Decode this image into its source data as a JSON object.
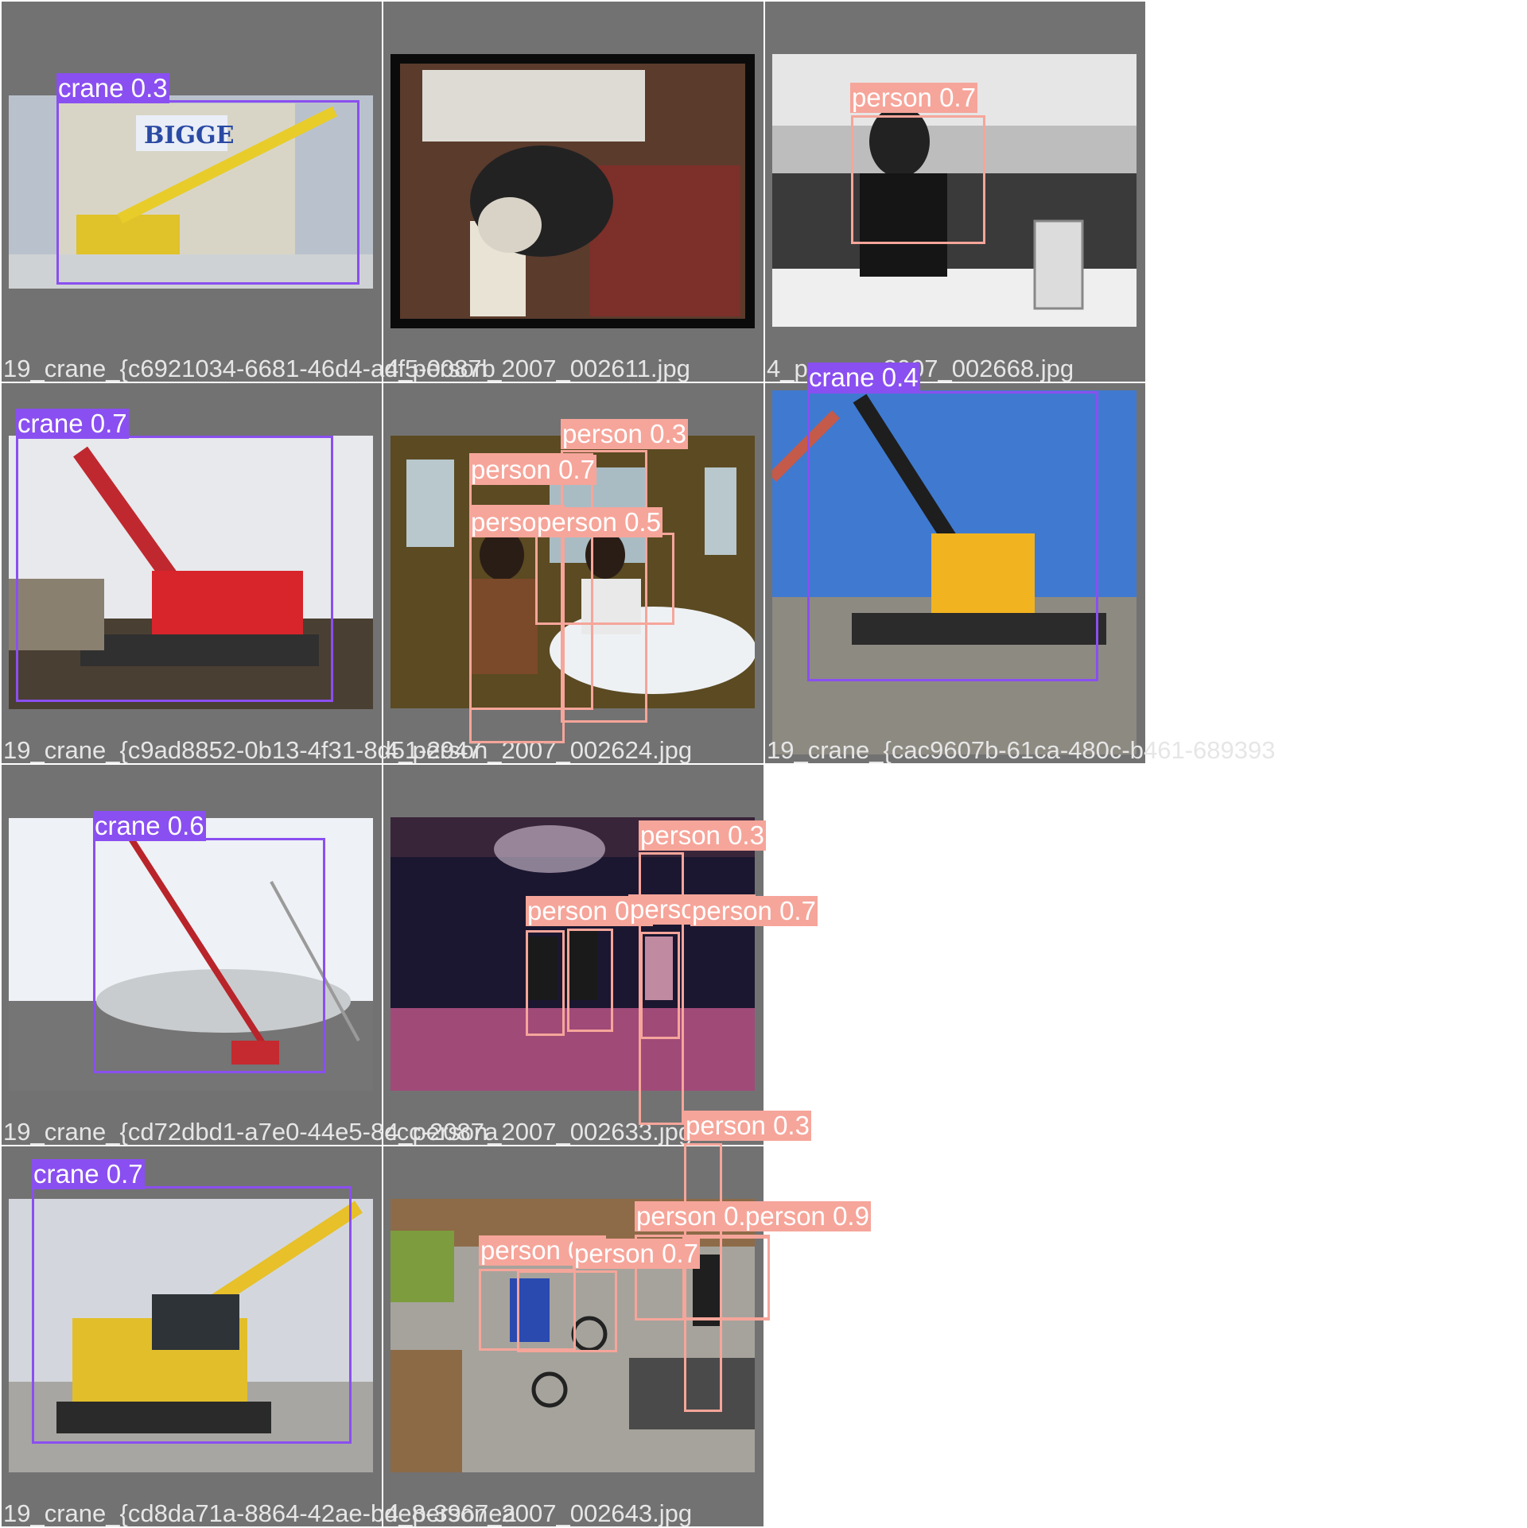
{
  "colors": {
    "crane": "#8a4ff0",
    "person": "#f6a59a",
    "tile_bg": "#727272"
  },
  "tiles": [
    {
      "filename": "19_crane_{c6921034-6681-46d4-adf5-0087b"
    },
    {
      "filename": "4_person_2007_002611.jpg"
    },
    {
      "filename": "4_person_2007_002668.jpg"
    },
    {
      "filename": "19_crane_{c9ad8852-0b13-4f31-8d51-2947"
    },
    {
      "filename": "4_person_2007_002624.jpg"
    },
    {
      "filename": "19_crane_{cac9607b-61ca-480c-b461-689393"
    },
    {
      "filename": "19_crane_{cd72dbd1-a7e0-44e5-8ccc-2087a"
    },
    {
      "filename": "4_person_2007_002633.jpg"
    },
    {
      "filename": "19_crane_{cd8da71a-8864-42ae-bde8-3967ea"
    },
    {
      "filename": "4_person_2007_002643.jpg"
    }
  ],
  "detections": [
    {
      "label": "crane 0.3"
    },
    {
      "label": "person 0.7"
    },
    {
      "label": "crane 0.7"
    },
    {
      "label": "person 0.3"
    },
    {
      "label": "person 0.7"
    },
    {
      "label": "person 0.7"
    },
    {
      "label": "person 0.5"
    },
    {
      "label": "crane 0.4"
    },
    {
      "label": "crane 0.6"
    },
    {
      "label": "person 0.3"
    },
    {
      "label": "person 0.6"
    },
    {
      "label": "person 0.6"
    },
    {
      "label": "person 0.7"
    },
    {
      "label": "person 0.3"
    },
    {
      "label": "crane 0.7"
    },
    {
      "label": "person 0.6"
    },
    {
      "label": "person 0.9"
    },
    {
      "label": "person 0.4"
    },
    {
      "label": "person 0.7"
    }
  ]
}
